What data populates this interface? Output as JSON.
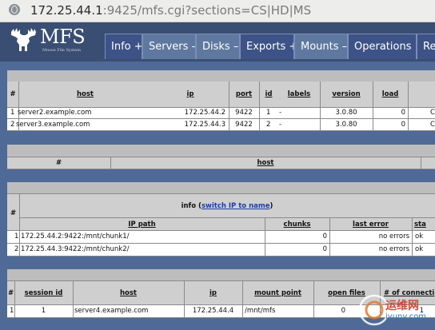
{
  "address_bar": {
    "host": "172.25.44.1",
    "rest": ":9425/mfs.cgi?sections=CS|HD|MS"
  },
  "logo": {
    "text": "MFS",
    "subtitle": "Moose File System"
  },
  "tabs": [
    {
      "label": "Info +",
      "state": "closed"
    },
    {
      "label": "Servers –",
      "state": "open"
    },
    {
      "label": "Disks –",
      "state": "open"
    },
    {
      "label": "Exports +",
      "state": "closed"
    },
    {
      "label": "Mounts –",
      "state": "open"
    },
    {
      "label": "Operations +",
      "state": "closed"
    },
    {
      "label": "Re",
      "state": "closed"
    }
  ],
  "servers_table": {
    "headers": {
      "num": "#",
      "host": "host",
      "ip": "ip",
      "port": "port",
      "id": "id",
      "labels": "labels",
      "version": "version",
      "load": "load",
      "extra": ""
    },
    "rows": [
      {
        "num": "1",
        "host": "server2.example.com",
        "ip": "172.25.44.2",
        "port": "9422",
        "id": "1",
        "labels": "-",
        "version": "3.0.80",
        "load": "0",
        "extra": "C"
      },
      {
        "num": "2",
        "host": "server3.example.com",
        "ip": "172.25.44.3",
        "port": "9422",
        "id": "2",
        "labels": "-",
        "version": "3.0.80",
        "load": "0",
        "extra": "C"
      }
    ]
  },
  "metaloggers_table": {
    "headers": {
      "num": "#",
      "host": "host"
    }
  },
  "disks_table": {
    "headers": {
      "num": "#",
      "info_prefix": "info (",
      "info_link": "switch IP to name",
      "info_suffix": ")",
      "ip_path": "IP path",
      "chunks": "chunks",
      "last_error": "last error",
      "status": "sta"
    },
    "rows": [
      {
        "num": "1",
        "ip_path": "172.25.44.2:9422:/mnt/chunk1/",
        "chunks": "0",
        "last_error": "no errors",
        "status": "ok"
      },
      {
        "num": "2",
        "ip_path": "172.25.44.3:9422:/mnt/chunk2/",
        "chunks": "0",
        "last_error": "no errors",
        "status": "ok"
      }
    ]
  },
  "mounts_table": {
    "headers": {
      "num": "#",
      "session_id": "session id",
      "host": "host",
      "ip": "ip",
      "mount_point": "mount point",
      "open_files": "open files",
      "connections": "# of connecti"
    },
    "rows": [
      {
        "num": "1",
        "session_id": "1",
        "host": "server4.example.com",
        "ip": "172.25.44.4",
        "mount_point": "/mnt/mfs",
        "open_files": "0",
        "connections": "1"
      }
    ]
  },
  "watermark": {
    "text": "运维网",
    "sub": "iyunv.com"
  }
}
